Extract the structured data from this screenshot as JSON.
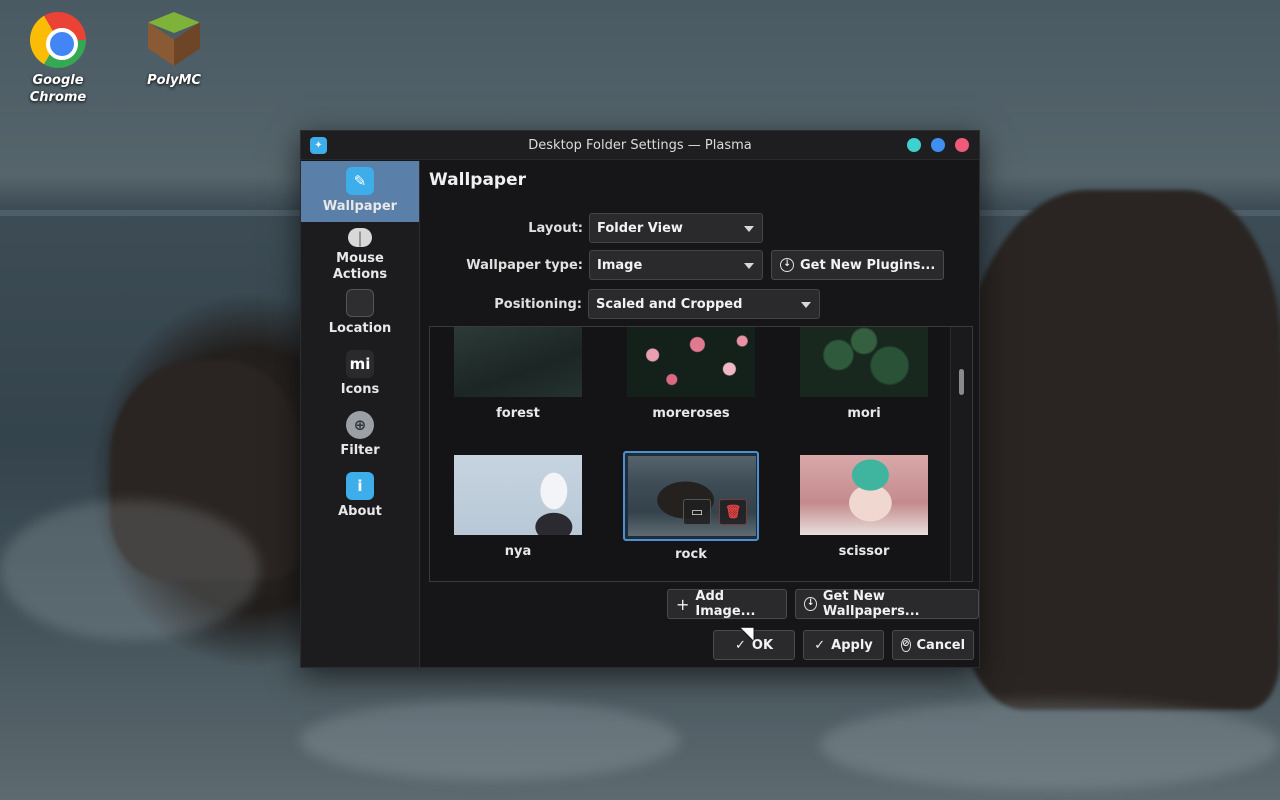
{
  "desktop": {
    "icons": [
      {
        "label": "Google\nChrome",
        "name": "chrome"
      },
      {
        "label": "PolyMC",
        "name": "polymc"
      }
    ]
  },
  "window": {
    "title": "Desktop Folder Settings — Plasma",
    "controls": {
      "minimize_color": "#3fd0d0",
      "maximize_color": "#3f8ff0",
      "close_color": "#f05a7a"
    }
  },
  "sidebar": {
    "items": [
      {
        "label": "Wallpaper",
        "icon": "wallpaper-icon"
      },
      {
        "label": "Mouse\nActions",
        "icon": "mouse-icon"
      },
      {
        "label": "Location",
        "icon": "folder-icon"
      },
      {
        "label": "Icons",
        "icon": "mi-icon"
      },
      {
        "label": "Filter",
        "icon": "filter-icon"
      },
      {
        "label": "About",
        "icon": "info-icon"
      }
    ],
    "active_color": "#5a7fa8"
  },
  "main": {
    "title": "Wallpaper",
    "layout_label": "Layout:",
    "layout_value": "Folder View",
    "wallpaper_type_label": "Wallpaper type:",
    "wallpaper_type_value": "Image",
    "get_plugins_label": "Get New Plugins...",
    "positioning_label": "Positioning:",
    "positioning_value": "Scaled and Cropped",
    "wallpapers": [
      "forest",
      "moreroses",
      "mori",
      "nya",
      "rock",
      "scissor"
    ],
    "selected_wallpaper": "rock",
    "add_image_label": "Add Image...",
    "get_wallpapers_label": "Get New Wallpapers...",
    "ok_label": "OK",
    "apply_label": "Apply",
    "cancel_label": "Cancel"
  }
}
